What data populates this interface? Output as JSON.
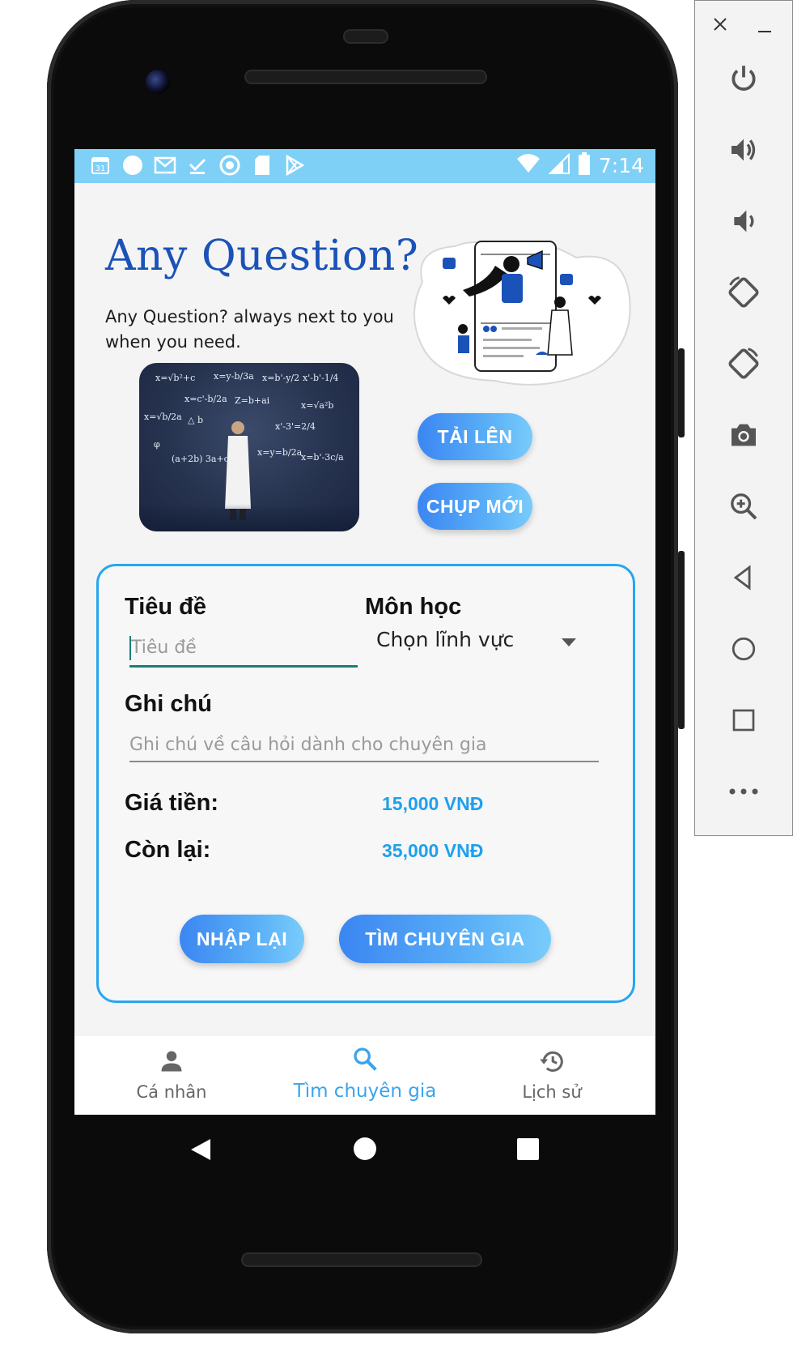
{
  "status_bar": {
    "time": "7:14",
    "left_icons": [
      "calendar-icon",
      "circle-icon",
      "gmail-icon",
      "check-icon",
      "record-icon",
      "sd-card-icon",
      "play-store-icon"
    ],
    "right_icons": [
      "wifi-icon",
      "signal-icon",
      "battery-icon"
    ],
    "calendar_day": "31"
  },
  "header": {
    "title": "Any Question?",
    "subtitle": "Any Question? always next to you when you need."
  },
  "actions": {
    "upload": "TẢI LÊN",
    "capture": "CHỤP MỚI"
  },
  "form": {
    "title_label": "Tiêu đề",
    "title_placeholder": "Tiêu đề",
    "subject_label": "Môn học",
    "subject_selected": "Chọn lĩnh vực",
    "note_label": "Ghi chú",
    "note_placeholder": "Ghi chú về câu hỏi dành cho chuyên gia",
    "price_label": "Giá tiền:",
    "price_value": "15,000 VNĐ",
    "remaining_label": "Còn lại:",
    "remaining_value": "35,000 VNĐ",
    "reset_button": "NHẬP LẠI",
    "find_button": "TÌM CHUYÊN GIA"
  },
  "bottom_nav": {
    "items": [
      {
        "label": "Cá nhân",
        "icon": "person-icon",
        "active": false
      },
      {
        "label": "Tìm chuyên gia",
        "icon": "search-icon",
        "active": true
      },
      {
        "label": "Lịch sử",
        "icon": "history-icon",
        "active": false
      }
    ]
  },
  "colors": {
    "accent": "#27a7ef",
    "title_blue": "#1b52b8",
    "status_bar": "#7fd0f6",
    "nav_active": "#3aa3ee"
  },
  "emulator_panel": {
    "buttons": [
      "close-icon",
      "minimize-icon",
      "power-icon",
      "volume-up-icon",
      "volume-down-icon",
      "rotate-left-icon",
      "rotate-right-icon",
      "camera-icon",
      "zoom-icon",
      "back-icon",
      "home-icon",
      "overview-icon",
      "more-icon"
    ]
  }
}
